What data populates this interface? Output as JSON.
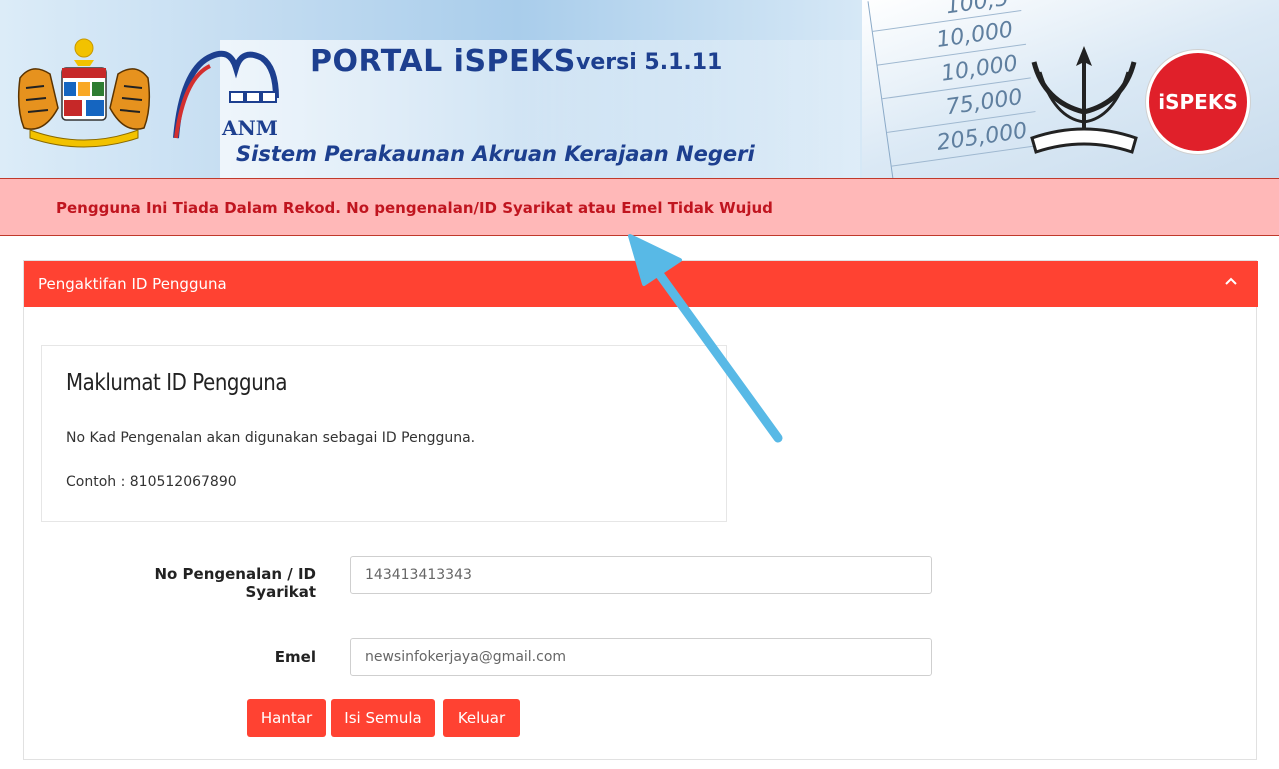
{
  "banner": {
    "title": "PORTAL iSPEKS",
    "version": "versi 5.1.11",
    "subtitle": "Sistem Perakaunan Akruan Kerajaan Negeri",
    "anm_label": "ANM",
    "logo_text": "iSPEKS",
    "spreadsheet_numbers": [
      "100,5",
      "10,000",
      "10,000",
      "75,000",
      "205,000"
    ],
    "coat_of_arms_icon": "malaysia-coat-of-arms-icon",
    "pahang_icon": "pahang-crest-icon"
  },
  "alert": {
    "message": "Pengguna Ini Tiada Dalam Rekod. No pengenalan/ID Syarikat atau Emel Tidak Wujud"
  },
  "panel": {
    "title": "Pengaktifan ID Pengguna",
    "info": {
      "heading": "Maklumat ID Pengguna",
      "line1": "No Kad Pengenalan akan digunakan sebagai ID Pengguna.",
      "line2": "Contoh : 810512067890"
    },
    "form": {
      "id_label": "No Pengenalan / ID Syarikat",
      "id_value": "143413413343",
      "email_label": "Emel",
      "email_value": "newsinfokerjaya@gmail.com"
    },
    "buttons": {
      "submit": "Hantar",
      "reset": "Isi Semula",
      "exit": "Keluar"
    }
  },
  "colors": {
    "accent": "#ff4232",
    "alert_bg": "#ffb8b8",
    "alert_text": "#c0151f",
    "title_blue": "#1d3f8f",
    "annotation_arrow": "#58b9e6"
  }
}
